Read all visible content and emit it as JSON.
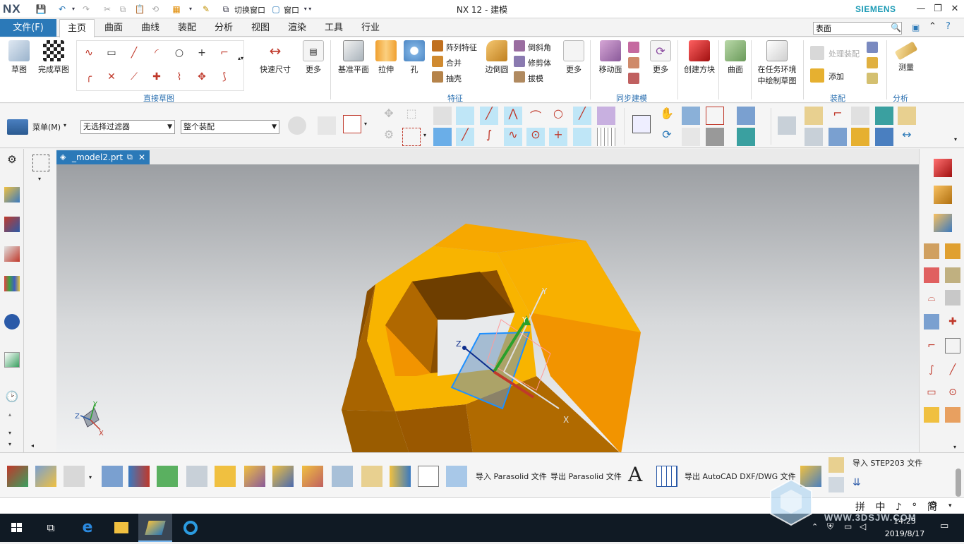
{
  "app": {
    "logo": "NX",
    "window_title": "NX 12 - 建模",
    "brand": "SIEMENS",
    "quick_access": {
      "switch_window": "切换窗口",
      "window_menu": "窗口"
    }
  },
  "ribbon_tabs": [
    "文件(F)",
    "主页",
    "曲面",
    "曲线",
    "装配",
    "分析",
    "视图",
    "渲染",
    "工具",
    "行业"
  ],
  "ribbon_search_value": "表面",
  "ribbon": {
    "sketch": "草图",
    "finish_sketch": "完成草图",
    "quick_dimension": "快速尺寸",
    "more_1": "更多",
    "group_direct_sketch": "直接草图",
    "datum_plane": "基准平面",
    "extrude": "拉伸",
    "hole": "孔",
    "pattern_feature": "阵列特征",
    "unite": "合并",
    "shell": "抽壳",
    "edge_blend": "边倒圆",
    "chamfer": "倒斜角",
    "trim_body": "修剪体",
    "draft": "拔模",
    "more_2": "更多",
    "group_feature": "特征",
    "move_face": "移动面",
    "more_3": "更多",
    "group_sync": "同步建模",
    "create_box": "创建方块",
    "surface": "曲面",
    "sketch_in_task": "在任务环境",
    "sketch_in_task_2": "中绘制草图",
    "process_assembly": "处理装配",
    "add": "添加",
    "group_assembly": "装配",
    "measure": "测量",
    "group_analysis": "分析"
  },
  "toolbar2": {
    "menu": "菜单(M)",
    "filter": "无选择过滤器",
    "scope": "整个装配"
  },
  "document_tab": "_model2.prt",
  "viewport": {
    "part_color": "#f7a800",
    "csys_labels": {
      "x": "X",
      "y": "Y",
      "z": "Z"
    }
  },
  "bottom_bar": {
    "import_parasolid": "导入 Parasolid 文件",
    "export_parasolid": "导出 Parasolid 文件",
    "export_autocad": "导出 AutoCAD DXF/DWG 文件",
    "import_step": "导入 STEP203 文件",
    "text_glyph": "A"
  },
  "status_bar": {
    "ime_text": "拼 中 ♪ ° 简"
  },
  "taskbar": {
    "time": "14:23",
    "date": "2019/8/17"
  },
  "watermark": "WWW.3DSJW.COM"
}
